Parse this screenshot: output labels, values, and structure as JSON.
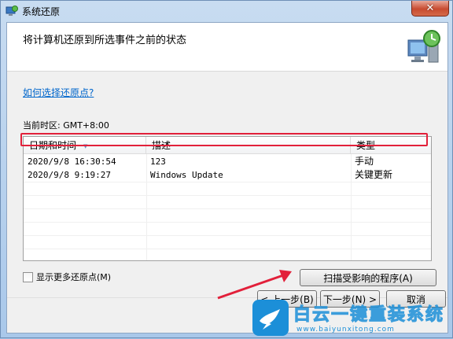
{
  "window": {
    "title": "系统还原",
    "close_label": "✕"
  },
  "header": {
    "heading": "将计算机还原到所选事件之前的状态"
  },
  "help_link": "如何选择还原点?",
  "timezone": "当前时区: GMT+8:00",
  "table": {
    "columns": [
      "日期和时间",
      "描述",
      "类型"
    ],
    "rows": [
      {
        "date": "2020/9/8 16:30:54",
        "description": "123",
        "type": "手动"
      },
      {
        "date": "2020/9/8 9:19:27",
        "description": "Windows Update",
        "type": "关键更新"
      }
    ]
  },
  "show_more_label": "显示更多还原点(M)",
  "scan_button_label": "扫描受影响的程序(A)",
  "footer_buttons": {
    "back": "< 上一步(B)",
    "next": "下一步(N) >",
    "cancel": "取消"
  },
  "watermark": {
    "main": "白云一键重装系统",
    "sub": "www.baiyunxitong.com"
  },
  "colors": {
    "highlight_border": "#e2203a",
    "link": "#0066cc",
    "annotation_arrow": "#e2203a",
    "watermark": "#1c8fd8"
  }
}
